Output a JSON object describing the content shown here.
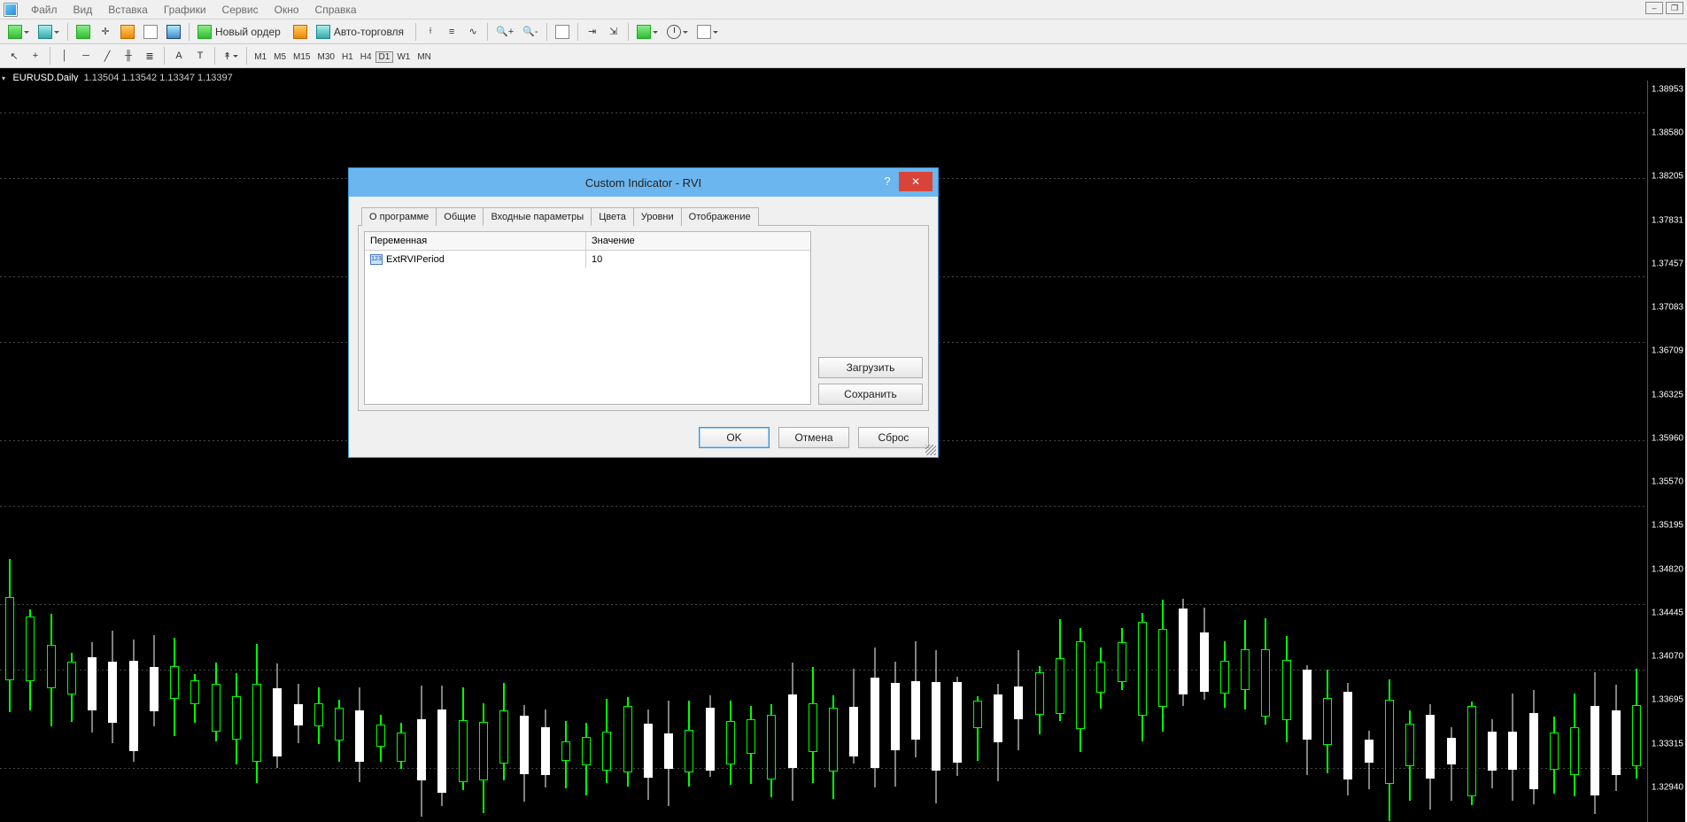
{
  "menu": {
    "items": [
      "Файл",
      "Вид",
      "Вставка",
      "Графики",
      "Сервис",
      "Окно",
      "Справка"
    ]
  },
  "toolbar1": {
    "new_order": "Новый ордер",
    "auto_trade": "Авто-торговля"
  },
  "timeframes": [
    "M1",
    "M5",
    "M15",
    "M30",
    "H1",
    "H4",
    "D1",
    "W1",
    "MN"
  ],
  "active_timeframe": "D1",
  "chart": {
    "symbol_line": "EURUSD,Daily",
    "quotes": "1.13504 1.13542 1.13347 1.13397"
  },
  "price_labels": [
    "1.38953",
    "1.38580",
    "1.38205",
    "1.37831",
    "1.37457",
    "1.37083",
    "1.36709",
    "1.36325",
    "1.35960",
    "1.35570",
    "1.35195",
    "1.34820",
    "1.34445",
    "1.34070",
    "1.33695",
    "1.33315",
    "1.32940"
  ],
  "dialog": {
    "title": "Custom Indicator - RVI",
    "tabs": [
      "О программе",
      "Общие",
      "Входные параметры",
      "Цвета",
      "Уровни",
      "Отображение"
    ],
    "active_tab": "Входные параметры",
    "grid": {
      "col_variable": "Переменная",
      "col_value": "Значение",
      "rows": [
        {
          "icon": "123",
          "name": "ExtRVIPeriod",
          "value": "10"
        }
      ]
    },
    "btn_load": "Загрузить",
    "btn_save": "Сохранить",
    "btn_ok": "OK",
    "btn_cancel": "Отмена",
    "btn_reset": "Сброс",
    "help": "?",
    "close": "✕"
  }
}
